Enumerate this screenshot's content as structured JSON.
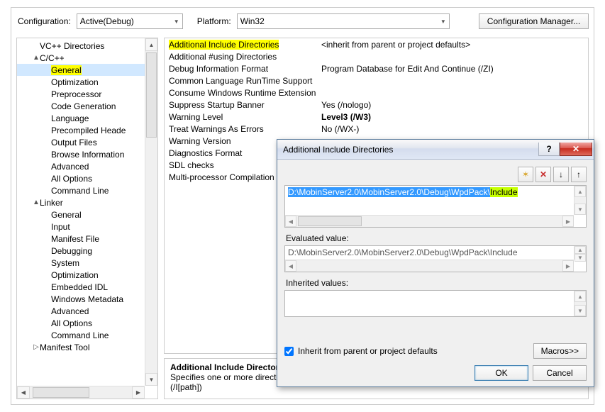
{
  "top": {
    "config_label": "Configuration:",
    "config_value": "Active(Debug)",
    "platform_label": "Platform:",
    "platform_value": "Win32",
    "config_mgr": "Configuration Manager..."
  },
  "tree": {
    "items": [
      {
        "label": "VC++ Directories",
        "indent": 1,
        "exp": "",
        "sel": false,
        "hl": false
      },
      {
        "label": "C/C++",
        "indent": 1,
        "exp": "▲",
        "sel": false,
        "hl": false
      },
      {
        "label": "General",
        "indent": 2,
        "exp": "",
        "sel": true,
        "hl": true
      },
      {
        "label": "Optimization",
        "indent": 2,
        "exp": "",
        "sel": false,
        "hl": false
      },
      {
        "label": "Preprocessor",
        "indent": 2,
        "exp": "",
        "sel": false,
        "hl": false
      },
      {
        "label": "Code Generation",
        "indent": 2,
        "exp": "",
        "sel": false,
        "hl": false
      },
      {
        "label": "Language",
        "indent": 2,
        "exp": "",
        "sel": false,
        "hl": false
      },
      {
        "label": "Precompiled Heade",
        "indent": 2,
        "exp": "",
        "sel": false,
        "hl": false
      },
      {
        "label": "Output Files",
        "indent": 2,
        "exp": "",
        "sel": false,
        "hl": false
      },
      {
        "label": "Browse Information",
        "indent": 2,
        "exp": "",
        "sel": false,
        "hl": false
      },
      {
        "label": "Advanced",
        "indent": 2,
        "exp": "",
        "sel": false,
        "hl": false
      },
      {
        "label": "All Options",
        "indent": 2,
        "exp": "",
        "sel": false,
        "hl": false
      },
      {
        "label": "Command Line",
        "indent": 2,
        "exp": "",
        "sel": false,
        "hl": false
      },
      {
        "label": "Linker",
        "indent": 1,
        "exp": "▲",
        "sel": false,
        "hl": false
      },
      {
        "label": "General",
        "indent": 2,
        "exp": "",
        "sel": false,
        "hl": false
      },
      {
        "label": "Input",
        "indent": 2,
        "exp": "",
        "sel": false,
        "hl": false
      },
      {
        "label": "Manifest File",
        "indent": 2,
        "exp": "",
        "sel": false,
        "hl": false
      },
      {
        "label": "Debugging",
        "indent": 2,
        "exp": "",
        "sel": false,
        "hl": false
      },
      {
        "label": "System",
        "indent": 2,
        "exp": "",
        "sel": false,
        "hl": false
      },
      {
        "label": "Optimization",
        "indent": 2,
        "exp": "",
        "sel": false,
        "hl": false
      },
      {
        "label": "Embedded IDL",
        "indent": 2,
        "exp": "",
        "sel": false,
        "hl": false
      },
      {
        "label": "Windows Metadata",
        "indent": 2,
        "exp": "",
        "sel": false,
        "hl": false
      },
      {
        "label": "Advanced",
        "indent": 2,
        "exp": "",
        "sel": false,
        "hl": false
      },
      {
        "label": "All Options",
        "indent": 2,
        "exp": "",
        "sel": false,
        "hl": false
      },
      {
        "label": "Command Line",
        "indent": 2,
        "exp": "",
        "sel": false,
        "hl": false
      },
      {
        "label": "Manifest Tool",
        "indent": 1,
        "exp": "▷",
        "sel": false,
        "hl": false
      }
    ]
  },
  "props": [
    {
      "name": "Additional Include Directories",
      "val": "<inherit from parent or project defaults>",
      "hl": true,
      "bold": false
    },
    {
      "name": "Additional #using Directories",
      "val": "",
      "hl": false,
      "bold": false
    },
    {
      "name": "Debug Information Format",
      "val": "Program Database for Edit And Continue (/ZI)",
      "hl": false,
      "bold": false
    },
    {
      "name": "Common Language RunTime Support",
      "val": "",
      "hl": false,
      "bold": false
    },
    {
      "name": "Consume Windows Runtime Extension",
      "val": "",
      "hl": false,
      "bold": false
    },
    {
      "name": "Suppress Startup Banner",
      "val": "Yes (/nologo)",
      "hl": false,
      "bold": false
    },
    {
      "name": "Warning Level",
      "val": "Level3 (/W3)",
      "hl": false,
      "bold": true
    },
    {
      "name": "Treat Warnings As Errors",
      "val": "No (/WX-)",
      "hl": false,
      "bold": false
    },
    {
      "name": "Warning Version",
      "val": "",
      "hl": false,
      "bold": false
    },
    {
      "name": "Diagnostics Format",
      "val": "",
      "hl": false,
      "bold": false
    },
    {
      "name": "SDL checks",
      "val": "",
      "hl": false,
      "bold": false
    },
    {
      "name": "Multi-processor Compilation",
      "val": "",
      "hl": false,
      "bold": false
    }
  ],
  "desc": {
    "title": "Additional Include Directories",
    "body": "Specifies one or more directories t",
    "body2": "(/I[path])"
  },
  "dialog": {
    "title": "Additional Include Directories",
    "path_pre": "D:\\MobinServer2.0\\MobinServer2.0\\Debug\\WpdPack\\",
    "path_hl": "Include",
    "eval_label": "Evaluated value:",
    "eval_value": "D:\\MobinServer2.0\\MobinServer2.0\\Debug\\WpdPack\\Include",
    "inherit_label": "Inherited values:",
    "inherit_chk": "Inherit from parent or project defaults",
    "macros": "Macros>>",
    "ok": "OK",
    "cancel": "Cancel",
    "help": "?"
  }
}
